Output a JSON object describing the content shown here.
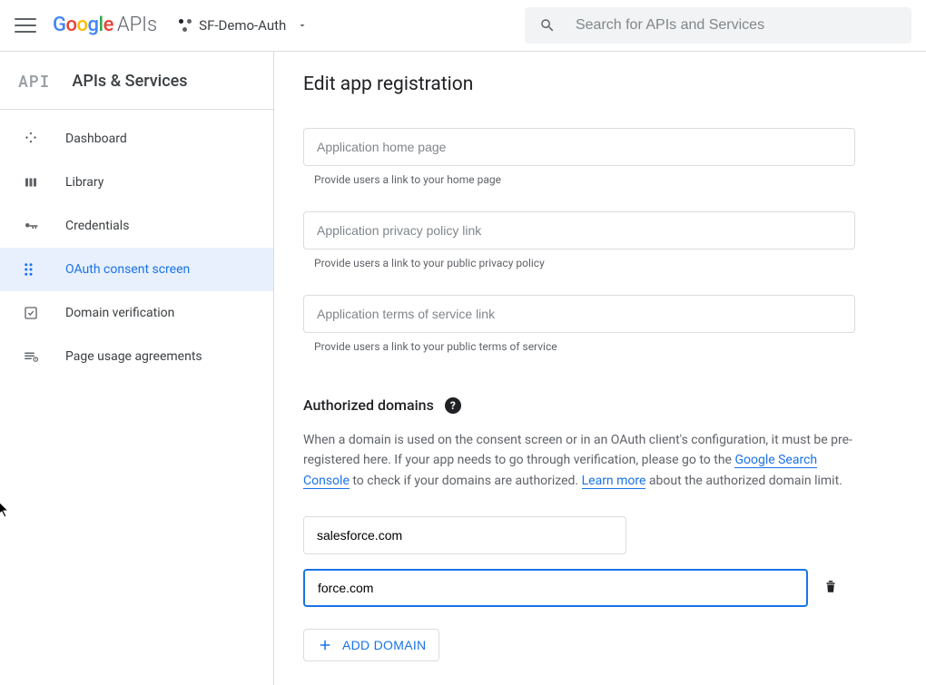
{
  "header": {
    "logo_suffix": "APIs",
    "project_name": "SF-Demo-Auth",
    "search_placeholder": "Search for APIs and Services"
  },
  "sidebar": {
    "badge": "API",
    "title": "APIs & Services",
    "items": [
      {
        "label": "Dashboard"
      },
      {
        "label": "Library"
      },
      {
        "label": "Credentials"
      },
      {
        "label": "OAuth consent screen"
      },
      {
        "label": "Domain verification"
      },
      {
        "label": "Page usage agreements"
      }
    ]
  },
  "main": {
    "title": "Edit app registration",
    "fields": {
      "home_page": {
        "placeholder": "Application home page",
        "hint": "Provide users a link to your home page"
      },
      "privacy": {
        "placeholder": "Application privacy policy link",
        "hint": "Provide users a link to your public privacy policy"
      },
      "tos": {
        "placeholder": "Application terms of service link",
        "hint": "Provide users a link to your public terms of service"
      }
    },
    "authorized_domains": {
      "title": "Authorized domains",
      "description_pre": "When a domain is used on the consent screen or in an OAuth client's configuration, it must be pre-registered here. If your app needs to go through verification, please go to the ",
      "link1": "Google Search Console",
      "description_mid": " to check if your domains are authorized. ",
      "link2": "Learn more",
      "description_post": " about the authorized domain limit.",
      "domains": [
        {
          "value": "salesforce.com"
        },
        {
          "value": "force.com"
        }
      ],
      "add_button": "ADD DOMAIN"
    }
  }
}
